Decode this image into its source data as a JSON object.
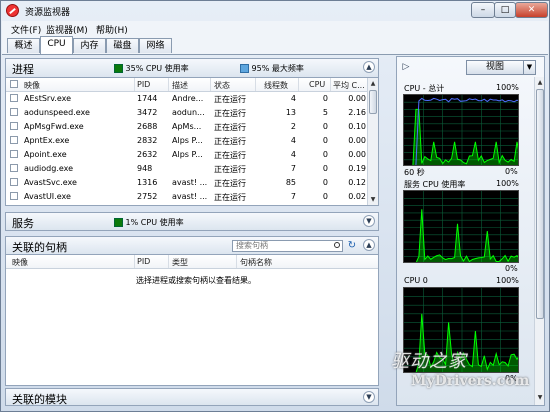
{
  "window": {
    "title": "资源监视器"
  },
  "menu": [
    "文件(F)",
    "监视器(M)",
    "帮助(H)"
  ],
  "tabs": [
    "概述",
    "CPU",
    "内存",
    "磁盘",
    "网络"
  ],
  "processes": {
    "title": "进程",
    "cpu_usage": "35% CPU 使用率",
    "max_freq": "95% 最大频率",
    "columns": [
      "映像",
      "PID",
      "描述",
      "状态",
      "线程数",
      "CPU",
      "平均 C..."
    ],
    "rows": [
      {
        "image": "AEstSrv.exe",
        "pid": "1744",
        "desc": "Andre...",
        "status": "正在运行",
        "threads": "4",
        "cpu": "0",
        "avg": "0.00"
      },
      {
        "image": "aodunspeed.exe",
        "pid": "3472",
        "desc": "aodun...",
        "status": "正在运行",
        "threads": "13",
        "cpu": "5",
        "avg": "2.16"
      },
      {
        "image": "ApMsgFwd.exe",
        "pid": "2688",
        "desc": "ApMs...",
        "status": "正在运行",
        "threads": "2",
        "cpu": "0",
        "avg": "0.10"
      },
      {
        "image": "ApntEx.exe",
        "pid": "2832",
        "desc": "Alps P...",
        "status": "正在运行",
        "threads": "4",
        "cpu": "0",
        "avg": "0.00"
      },
      {
        "image": "Apoint.exe",
        "pid": "2632",
        "desc": "Alps P...",
        "status": "正在运行",
        "threads": "4",
        "cpu": "0",
        "avg": "0.00"
      },
      {
        "image": "audiodg.exe",
        "pid": "948",
        "desc": "",
        "status": "正在运行",
        "threads": "7",
        "cpu": "0",
        "avg": "0.19"
      },
      {
        "image": "AvastSvc.exe",
        "pid": "1316",
        "desc": "avast! ...",
        "status": "正在运行",
        "threads": "85",
        "cpu": "0",
        "avg": "0.12"
      },
      {
        "image": "AvastUI.exe",
        "pid": "2752",
        "desc": "avast! ...",
        "status": "正在运行",
        "threads": "7",
        "cpu": "0",
        "avg": "0.02"
      }
    ]
  },
  "services": {
    "title": "服务",
    "cpu_usage": "1% CPU 使用率"
  },
  "handles": {
    "title": "关联的句柄",
    "search_placeholder": "搜索句柄",
    "columns": [
      "映像",
      "PID",
      "类型",
      "句柄名称"
    ],
    "empty_message": "选择进程或搜索句柄以查看结果。"
  },
  "modules": {
    "title": "关联的模块"
  },
  "right_panel": {
    "view_label": "视图",
    "graphs": [
      {
        "label": "CPU - 总计",
        "max": "100%",
        "min_time": "60 秒",
        "min": "0%"
      },
      {
        "label": "服务 CPU 使用率",
        "max": "100%",
        "min": "0%"
      },
      {
        "label": "CPU 0",
        "max": "100%",
        "min": "0%"
      }
    ]
  },
  "watermark": {
    "line1": "驱动之家",
    "line2": "MyDrivers.com"
  },
  "colors": {
    "green_series": "#00ff00",
    "blue_series": "#4f6fff",
    "grid": "#0b5e3a"
  }
}
